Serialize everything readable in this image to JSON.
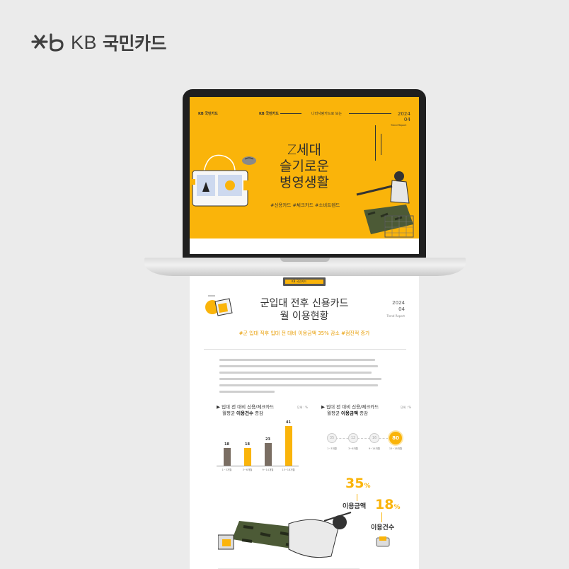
{
  "brand": {
    "latin": "KB",
    "korean": "국민카드",
    "mark_icon": "kb-star-logo-icon"
  },
  "screen": {
    "logo_text": "KB 국민카드",
    "header_left": "KB 국민카드",
    "header_right": "나라사랑카드로 보는",
    "year": "2024",
    "month": "04",
    "report_label": "Trend Report",
    "title_lines": [
      "Z세대",
      "슬기로운",
      "병영생활"
    ],
    "tags": "#신용카드 #체크카드 #소비트렌드",
    "accent_color": "#fab40a"
  },
  "document": {
    "tab_label": "KB 국민카드",
    "title_lines": [
      "군입대 전후 신용카드",
      "월 이용현황"
    ],
    "year": "2024",
    "month": "04",
    "report_label": "Trend Report",
    "subtitle": "#군 입대 직후 입대 전 대비 이용금액 35% 감소 #점진적 증가",
    "chart_left": {
      "heading": "▶ 입대 전 대비 신용/체크카드",
      "heading2_plain": "월평균 ",
      "heading2_bold": "이용건수",
      "heading2_tail": " 증감",
      "unit": "단위 : %"
    },
    "chart_right": {
      "heading": "▶ 입대 전 대비 신용/체크카드",
      "heading2_plain": "월평균 ",
      "heading2_bold": "이용금액",
      "heading2_tail": " 증감",
      "unit": "단위 : %"
    },
    "pct_amount": "35",
    "pct_amount_label": "이용금액",
    "pct_count": "18",
    "pct_count_label": "이용건수",
    "pct_sign": "%"
  },
  "chart_data": [
    {
      "type": "bar",
      "title": "입대 전 대비 신용/체크카드 월평균 이용건수 증감",
      "categories": [
        "1~3개월",
        "3~6개월",
        "9~14개월",
        "15~18개월"
      ],
      "values": [
        18,
        18,
        23,
        41
      ],
      "colors": [
        "#7a6e63",
        "#fab40a",
        "#7a6e63",
        "#fab40a"
      ],
      "ylim": [
        0,
        45
      ]
    },
    {
      "type": "scatter",
      "title": "입대 전 대비 신용/체크카드 월평균 이용금액 증감",
      "categories": [
        "1~3개월",
        "3~6개월",
        "9~14개월",
        "15~18개월"
      ],
      "values": [
        35,
        12,
        16,
        80
      ],
      "highlight_index": 3
    }
  ]
}
